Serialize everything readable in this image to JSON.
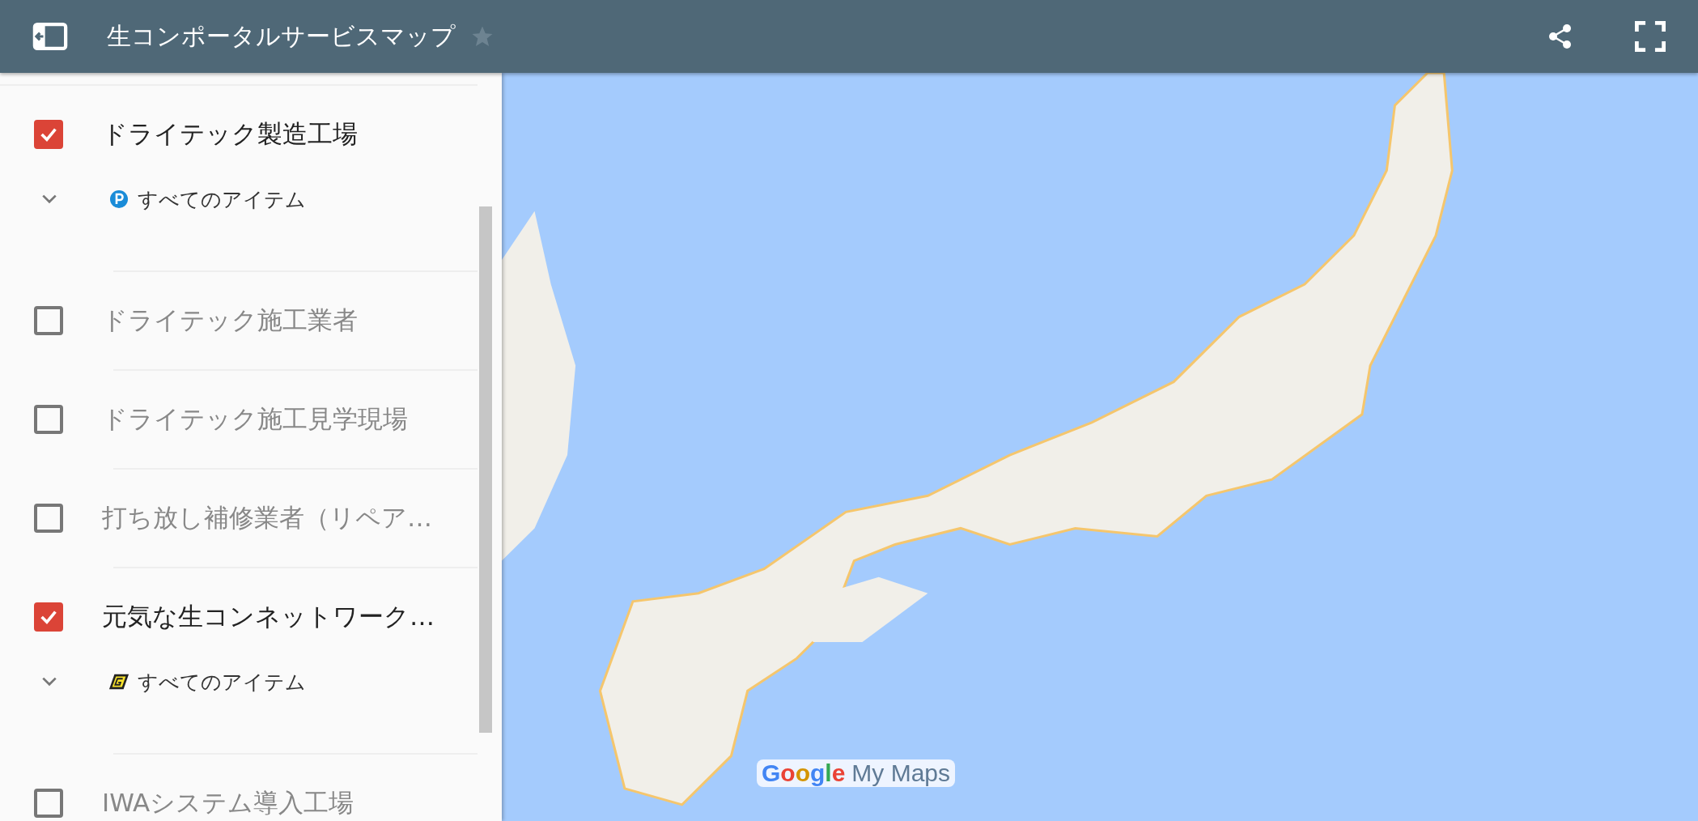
{
  "header": {
    "title": "生コンポータルサービスマップ",
    "starred": false
  },
  "layers": [
    {
      "title": "ドライテック製造工場",
      "checked": true,
      "expanded": false,
      "items": [
        {
          "label": "すべてのアイテム",
          "kind": "parking"
        }
      ]
    },
    {
      "title": "ドライテック施工業者",
      "checked": false
    },
    {
      "title": "ドライテック施工見学現場",
      "checked": false
    },
    {
      "title": "打ち放し補修業者（リペア…",
      "checked": false
    },
    {
      "title": "元気な生コンネットワーク…",
      "checked": true,
      "expanded": false,
      "items": [
        {
          "label": "すべてのアイテム",
          "kind": "logo"
        }
      ]
    },
    {
      "title": "IWAシステム導入工場",
      "checked": false
    }
  ],
  "map": {
    "logo_brand": "Google",
    "logo_product": "My Maps"
  }
}
